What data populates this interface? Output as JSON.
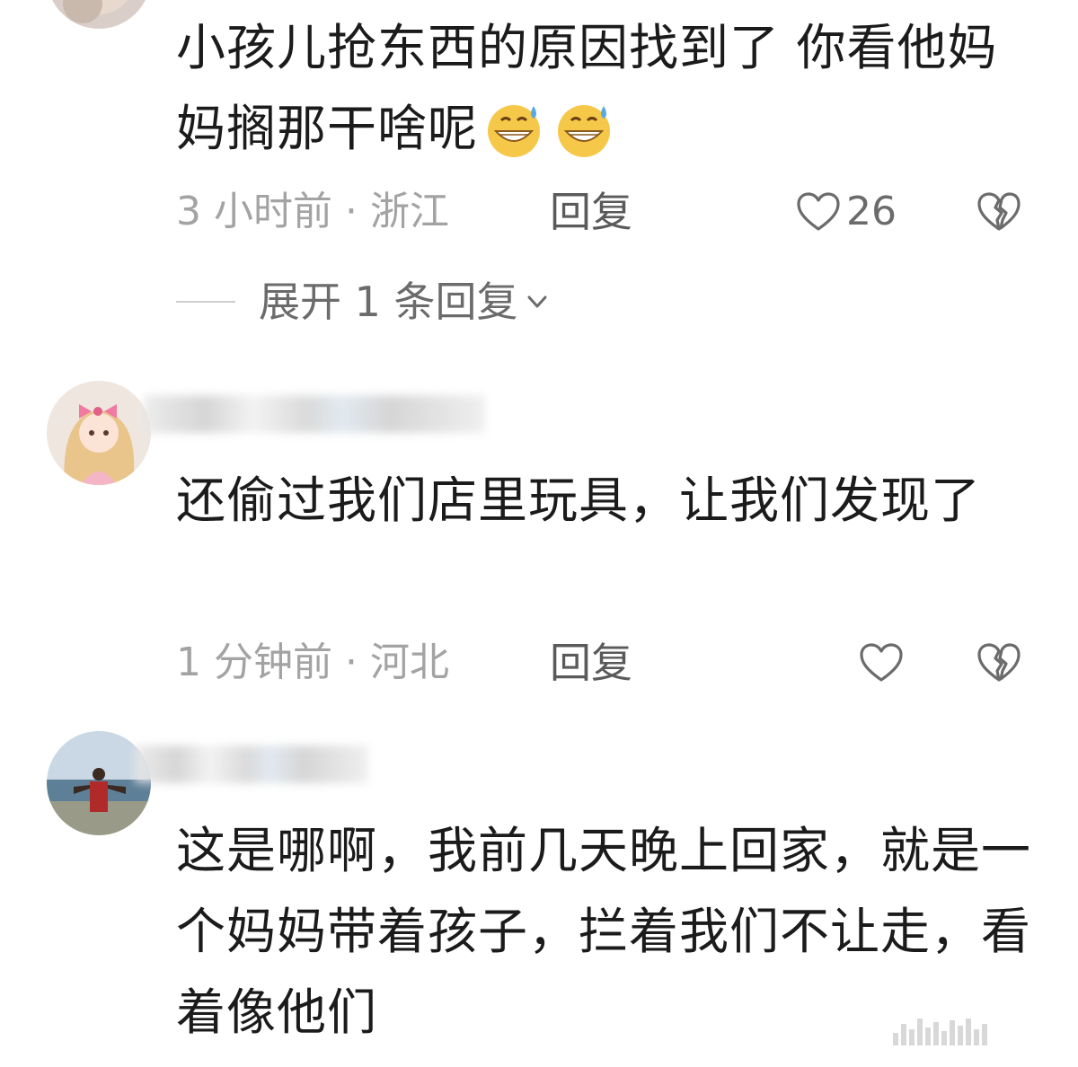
{
  "comments": [
    {
      "text": "小孩儿抢东西的原因找到了 你看他妈妈搁那干啥呢",
      "time_location": "3 小时前 · 浙江",
      "reply_label": "回复",
      "like_count": "26",
      "expand_replies": "展开 1 条回复"
    },
    {
      "text": "还偷过我们店里玩具，让我们发现了",
      "time_location": "1 分钟前 · 河北",
      "reply_label": "回复"
    },
    {
      "text": "这是哪啊，我前几天晚上回家，就是一个妈妈带着孩子，拦着我们不让走，看着像他们"
    }
  ],
  "icons": {
    "like": "heart-outline-icon",
    "dislike": "broken-heart-icon",
    "expand": "chevron-down-icon",
    "emoji": "grinning-sweat-emoji"
  },
  "colors": {
    "text": "#1b1b1b",
    "meta": "#a3a3a3",
    "action": "#5a5a5a"
  }
}
